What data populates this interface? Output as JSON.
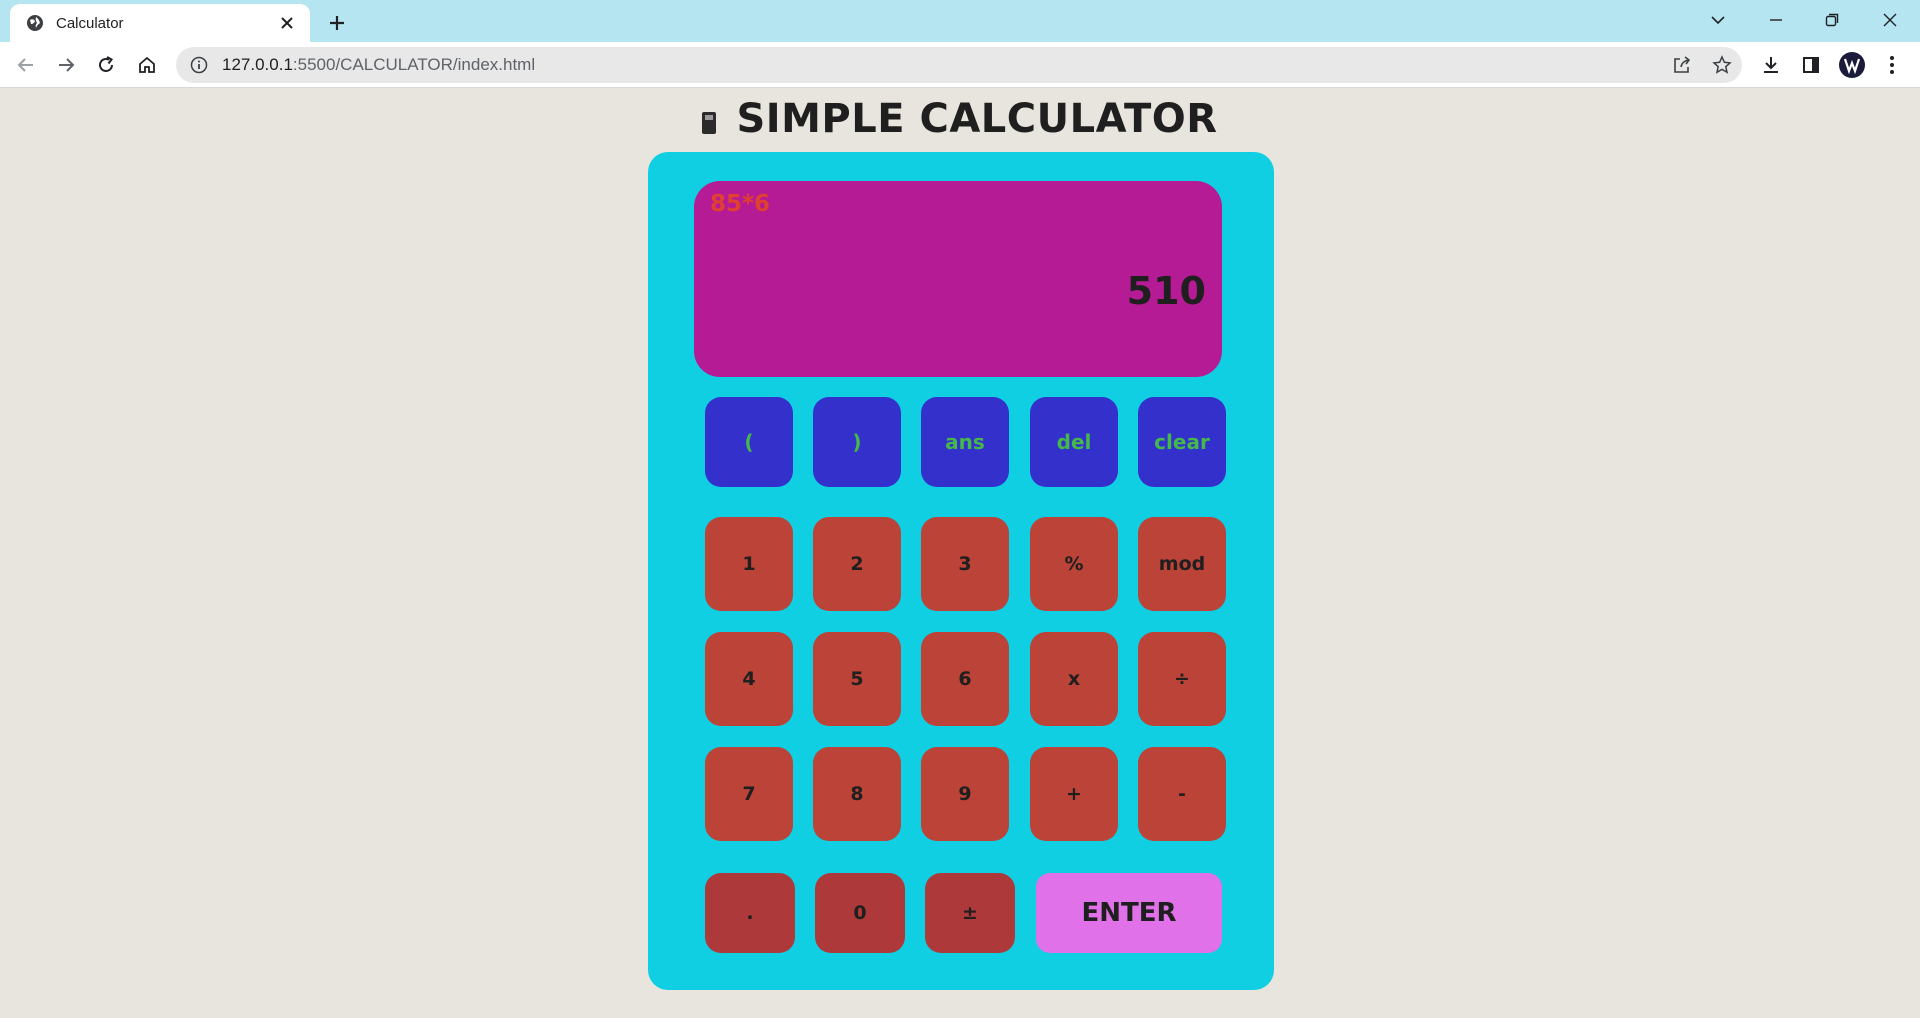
{
  "browser": {
    "tab_title": "Calculator",
    "url_host": "127.0.0.1",
    "url_rest": ":5500/CALCULATOR/index.html"
  },
  "page": {
    "title": "SIMPLE CALCULATOR"
  },
  "display": {
    "expression": "85*6",
    "result": "510"
  },
  "keys": {
    "row_fn": [
      "(",
      ")",
      "ans",
      "del",
      "clear"
    ],
    "row1": [
      "1",
      "2",
      "3",
      "%",
      "mod"
    ],
    "row2": [
      "4",
      "5",
      "6",
      "x",
      "÷"
    ],
    "row3": [
      "7",
      "8",
      "9",
      "+",
      "-"
    ],
    "row_last": [
      ".",
      "0",
      "±"
    ],
    "enter": "ENTER"
  },
  "colors": {
    "body_bg": "#e7e5dd",
    "calculator_bg": "#10cfe2",
    "screen_bg": "#b51b95",
    "expression_text": "#e0402f",
    "function_key_bg": "#3430cc",
    "function_key_text": "#45b84a",
    "number_key_bg": "#bb4337",
    "bottom_key_bg": "#ad393a",
    "enter_key_bg": "#e171e8"
  },
  "icons": {
    "tab": "globe-icon",
    "tab_close": "close-icon",
    "new_tab": "plus-icon",
    "nav": [
      "back-arrow-icon",
      "forward-arrow-icon",
      "reload-icon",
      "home-icon"
    ],
    "omnibox": [
      "info-icon",
      "share-icon",
      "star-icon"
    ],
    "toolbar": [
      "download-icon",
      "side-panel-icon",
      "profile-avatar-icon",
      "kebab-menu-icon"
    ],
    "window": [
      "tab-search-chevron-icon",
      "minimize-icon",
      "restore-icon",
      "window-close-icon"
    ],
    "title": "calculator-emoji-icon"
  }
}
